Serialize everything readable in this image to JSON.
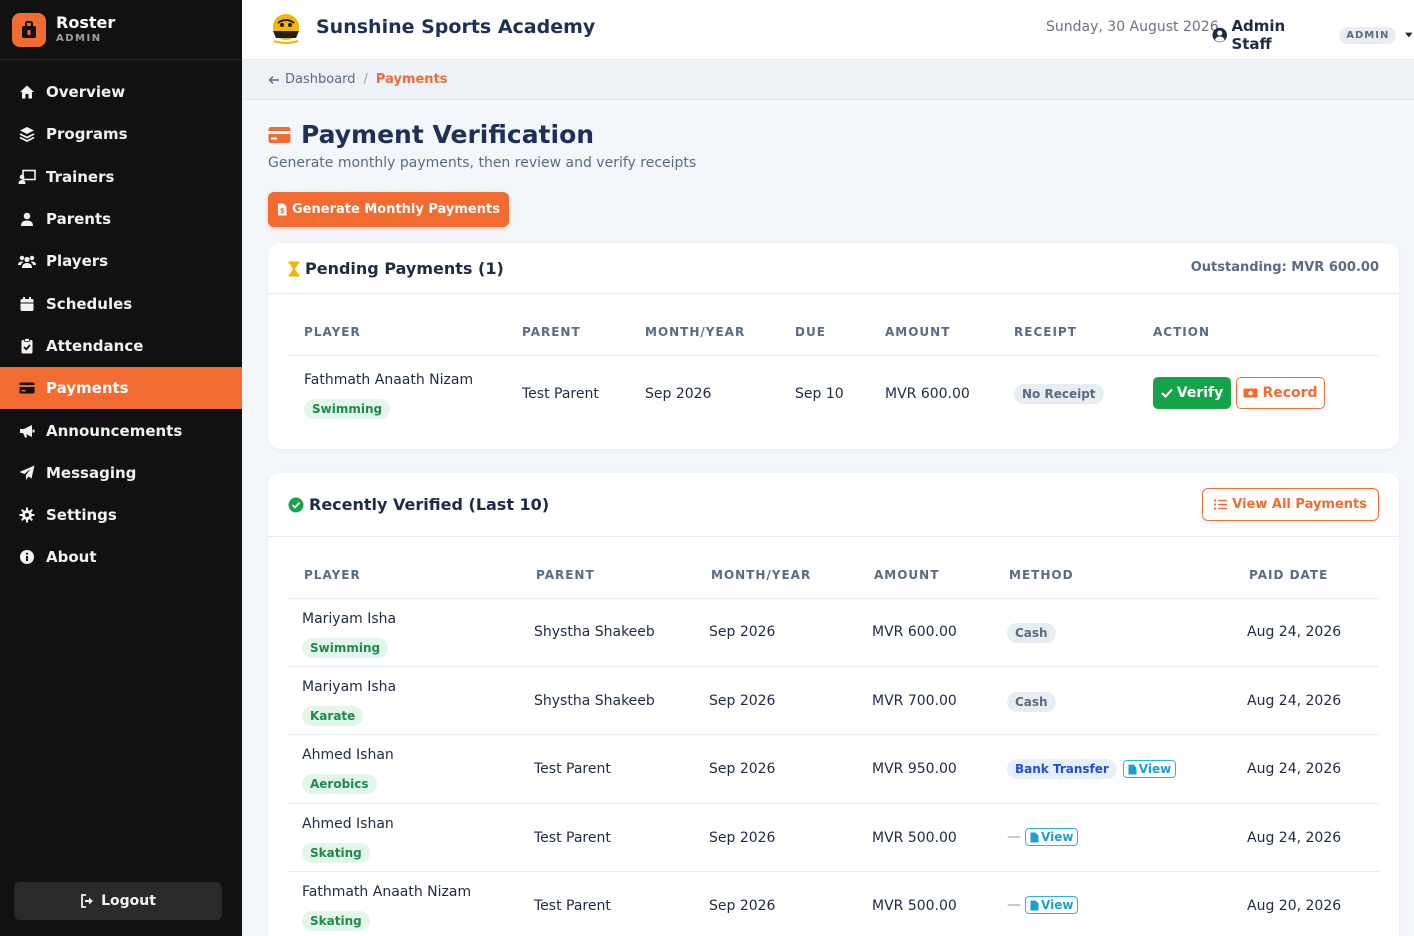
{
  "sidebar": {
    "brand_name": "Roster",
    "brand_role": "ADMIN",
    "items": [
      {
        "label": "Overview",
        "icon": "home-icon"
      },
      {
        "label": "Programs",
        "icon": "layers-icon"
      },
      {
        "label": "Trainers",
        "icon": "trainer-icon"
      },
      {
        "label": "Parents",
        "icon": "user-icon"
      },
      {
        "label": "Players",
        "icon": "users-icon"
      },
      {
        "label": "Schedules",
        "icon": "calendar-icon"
      },
      {
        "label": "Attendance",
        "icon": "clipboard-check-icon"
      },
      {
        "label": "Payments",
        "icon": "credit-card-icon",
        "active": true
      },
      {
        "label": "Announcements",
        "icon": "megaphone-icon"
      },
      {
        "label": "Messaging",
        "icon": "paper-plane-icon"
      },
      {
        "label": "Settings",
        "icon": "gear-icon"
      },
      {
        "label": "About",
        "icon": "info-circle-icon"
      }
    ],
    "logout_label": "Logout"
  },
  "header": {
    "academy_name": "Sunshine Sports Academy",
    "date": "Sunday, 30 August 2026",
    "user_name": "Admin Staff",
    "role_badge": "ADMIN"
  },
  "breadcrumb": {
    "parent": "Dashboard",
    "separator": "/",
    "current": "Payments"
  },
  "page": {
    "title": "Payment Verification",
    "subtitle": "Generate monthly payments, then review and verify receipts",
    "generate_button": "Generate Monthly Payments"
  },
  "pending": {
    "title": "Pending Payments (1)",
    "outstanding": "Outstanding: MVR 600.00",
    "columns": [
      "PLAYER",
      "PARENT",
      "MONTH/YEAR",
      "DUE",
      "AMOUNT",
      "RECEIPT",
      "ACTION"
    ],
    "rows": [
      {
        "player": "Fathmath Anaath Nizam",
        "sport": "Swimming",
        "parent": "Test Parent",
        "month": "Sep 2026",
        "due": "Sep 10",
        "amount": "MVR 600.00",
        "receipt": "No Receipt",
        "verify_label": "Verify",
        "record_label": "Record"
      }
    ]
  },
  "verified": {
    "title": "Recently Verified (Last 10)",
    "view_all": "View All Payments",
    "columns": [
      "PLAYER",
      "PARENT",
      "MONTH/YEAR",
      "AMOUNT",
      "METHOD",
      "PAID DATE"
    ],
    "rows": [
      {
        "player": "Mariyam Isha",
        "sport": "Swimming",
        "parent": "Shystha Shakeeb",
        "month": "Sep 2026",
        "amount": "MVR 600.00",
        "method": "Cash",
        "paid": "Aug 24, 2026"
      },
      {
        "player": "Mariyam Isha",
        "sport": "Karate",
        "parent": "Shystha Shakeeb",
        "month": "Sep 2026",
        "amount": "MVR 700.00",
        "method": "Cash",
        "paid": "Aug 24, 2026"
      },
      {
        "player": "Ahmed Ishan",
        "sport": "Aerobics",
        "parent": "Test Parent",
        "month": "Sep 2026",
        "amount": "MVR 950.00",
        "method": "Bank Transfer",
        "view": "View",
        "paid": "Aug 24, 2026"
      },
      {
        "player": "Ahmed Ishan",
        "sport": "Skating",
        "parent": "Test Parent",
        "month": "Sep 2026",
        "amount": "MVR 500.00",
        "method": "—",
        "view": "View",
        "paid": "Aug 24, 2026"
      },
      {
        "player": "Fathmath Anaath Nizam",
        "sport": "Skating",
        "parent": "Test Parent",
        "month": "Sep 2026",
        "amount": "MVR 500.00",
        "method": "—",
        "view": "View",
        "paid": "Aug 20, 2026"
      }
    ]
  },
  "colors": {
    "accent": "#f26b30",
    "sidebar_bg": "#111111",
    "success": "#17a34a",
    "title": "#1f3056"
  }
}
